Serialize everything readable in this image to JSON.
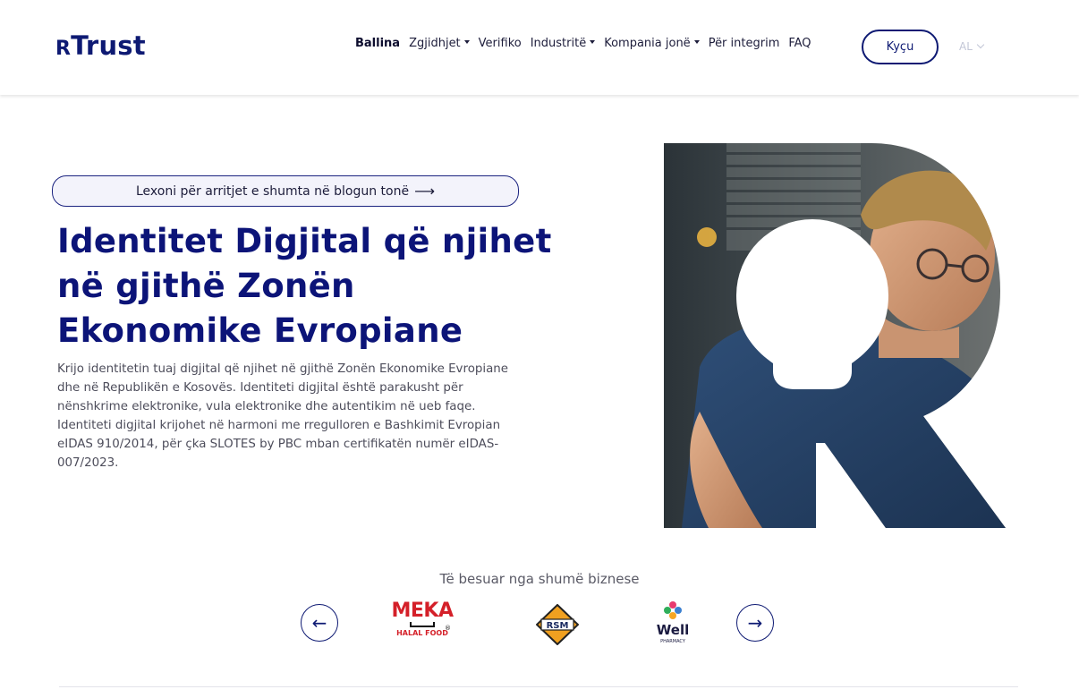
{
  "header": {
    "logo_prefix": "R",
    "logo_text": "Trust",
    "nav": [
      {
        "label": "Ballina",
        "active": true,
        "dropdown": false
      },
      {
        "label": "Zgjidhjet",
        "active": false,
        "dropdown": true
      },
      {
        "label": "Verifiko",
        "active": false,
        "dropdown": false
      },
      {
        "label": "Industritë",
        "active": false,
        "dropdown": true
      },
      {
        "label": "Kompania jonë",
        "active": false,
        "dropdown": true
      },
      {
        "label": "Për integrim",
        "active": false,
        "dropdown": false
      },
      {
        "label": "FAQ",
        "active": false,
        "dropdown": false
      }
    ],
    "login_label": "Kyçu",
    "language": "AL"
  },
  "hero": {
    "blog_link": "Lexoni për arritjet e shumta në blogun tonë",
    "title_line1": "Identitet Digjital që njihet",
    "title_line2": "në gjithë Zonën",
    "title_line3": "Ekonomike Evropiane",
    "description": "Krijo identitetin tuaj digjital që njihet në gjithë Zonën Ekonomike Evropiane dhe në Republikën e Kosovës. Identiteti digjital është parakusht për nënshkrime elektronike, vula elektronike dhe autentikim në ueb faqe. Identiteti digjital krijohet në harmoni me rregulloren e Bashkimit Evropian eIDAS 910/2014, për çka SLOTES by PBC mban certifikatën numër eIDAS-007/2023."
  },
  "trusted": {
    "heading": "Të besuar nga shumë biznese",
    "logos": [
      {
        "name": "MEKA",
        "subtitle": "HALAL FOOD",
        "registered": "®"
      },
      {
        "name": "RSM"
      },
      {
        "name": "Well",
        "subtitle": "PHARMACY"
      }
    ]
  },
  "colors": {
    "brand_navy": "#0e1a73",
    "text_gray": "#4d4d5b",
    "meka_red": "#d42029",
    "rsm_orange": "#f0a020"
  },
  "icons": {
    "prev": "arrow-left-icon",
    "next": "arrow-right-icon",
    "blog_arrow": "arrow-right-icon",
    "lang": "chevron-down-icon"
  }
}
